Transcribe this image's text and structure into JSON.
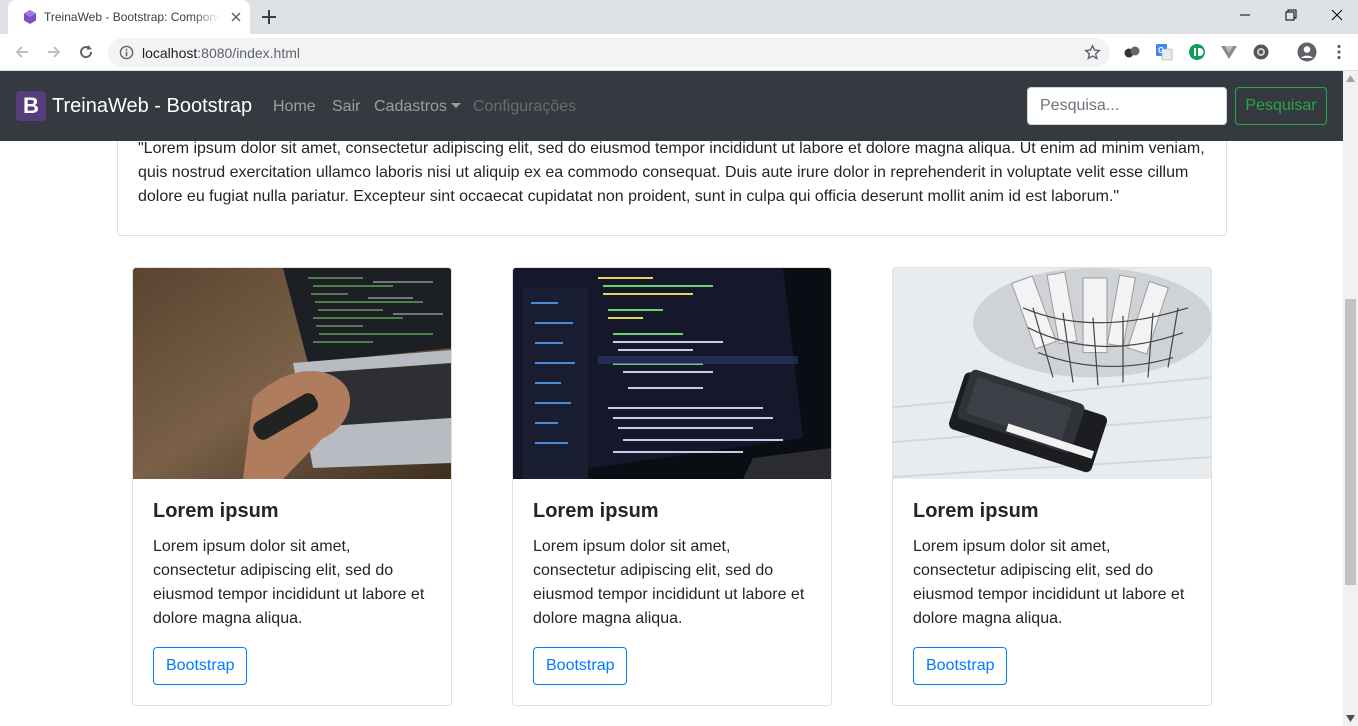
{
  "browser": {
    "tab_title": "TreinaWeb - Bootstrap: Componentes",
    "url_host": "localhost",
    "url_rest": ":8080/index.html"
  },
  "navbar": {
    "brand_letter": "B",
    "brand_text": "TreinaWeb - Bootstrap",
    "links": [
      "Home",
      "Sair",
      "Cadastros",
      "Configurações"
    ],
    "search_placeholder": "Pesquisa...",
    "search_button": "Pesquisar"
  },
  "quote": {
    "text": "\"Lorem ipsum dolor sit amet, consectetur adipiscing elit, sed do eiusmod tempor incididunt ut labore et dolore magna aliqua. Ut enim ad minim veniam, quis nostrud exercitation ullamco laboris nisi ut aliquip ex ea commodo consequat. Duis aute irure dolor in reprehenderit in voluptate velit esse cillum dolore eu fugiat nulla pariatur. Excepteur sint occaecat cupidatat non proident, sunt in culpa qui officia deserunt mollit anim id est laborum.\""
  },
  "cards": [
    {
      "title": "Lorem ipsum",
      "text": "Lorem ipsum dolor sit amet, consectetur adipiscing elit, sed do eiusmod tempor incididunt ut labore et dolore magna aliqua.",
      "button": "Bootstrap"
    },
    {
      "title": "Lorem ipsum",
      "text": "Lorem ipsum dolor sit amet, consectetur adipiscing elit, sed do eiusmod tempor incididunt ut labore et dolore magna aliqua.",
      "button": "Bootstrap"
    },
    {
      "title": "Lorem ipsum",
      "text": "Lorem ipsum dolor sit amet, consectetur adipiscing elit, sed do eiusmod tempor incididunt ut labore et dolore magna aliqua.",
      "button": "Bootstrap"
    }
  ],
  "colors": {
    "navbar_bg": "#343a40",
    "brand_logo": "#563d7c",
    "success": "#28a745",
    "primary": "#007bff"
  }
}
